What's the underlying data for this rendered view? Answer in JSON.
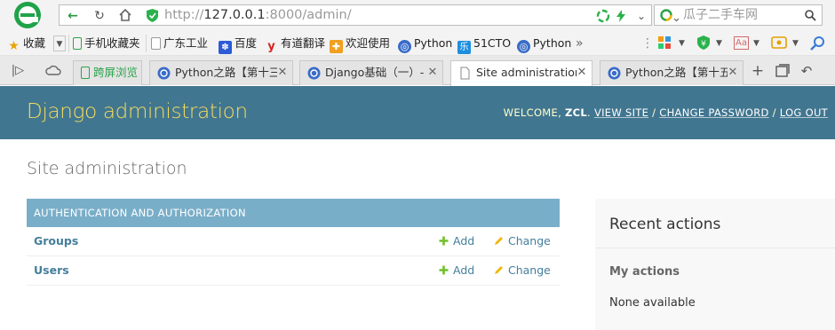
{
  "browser": {
    "url_scheme": "http://",
    "url_host": "127.0.0.1",
    "url_rest": ":8000/admin/",
    "search_placeholder": "瓜子二手车网",
    "bookmarks": [
      {
        "label": "收藏",
        "icon": "star-icon"
      },
      {
        "label": "手机收藏夹",
        "icon": "phone-icon"
      },
      {
        "label": "广东工业",
        "icon": "page-icon"
      },
      {
        "label": "百度",
        "icon": "baidu-paw-icon"
      },
      {
        "label": "有道翻译",
        "icon": "youdao-icon"
      },
      {
        "label": "欢迎使用",
        "icon": "puzzle-icon"
      },
      {
        "label": "Python",
        "icon": "globe-icon"
      },
      {
        "label": "51CTO",
        "icon": "cto-icon"
      },
      {
        "label": "Python",
        "icon": "globe-icon"
      }
    ],
    "tabs": [
      {
        "label": "跨屏浏览",
        "active": false
      },
      {
        "label": "Python之路【第十三",
        "active": false
      },
      {
        "label": "Django基础（一）-",
        "active": false
      },
      {
        "label": "Site administration",
        "active": true
      },
      {
        "label": "Python之路【第十五",
        "active": false
      }
    ]
  },
  "admin": {
    "branding": "Django administration",
    "welcome": "WELCOME, ",
    "username": "ZCL",
    "view_site": "VIEW SITE",
    "change_password": "CHANGE PASSWORD",
    "log_out": "LOG OUT",
    "sep": " / ",
    "page_title": "Site administration",
    "module_caption": "AUTHENTICATION AND AUTHORIZATION",
    "models": [
      {
        "name": "Groups",
        "add": "Add",
        "change": "Change"
      },
      {
        "name": "Users",
        "add": "Add",
        "change": "Change"
      }
    ],
    "recent_title": "Recent actions",
    "my_actions": "My actions",
    "none_available": "None available"
  },
  "colors": {
    "header_bg": "#417690",
    "branding": "#f5dd5d",
    "caption_bg": "#79aec8",
    "link": "#447e9b",
    "add_green": "#70bf2b",
    "change_yellow": "#efb80b"
  }
}
